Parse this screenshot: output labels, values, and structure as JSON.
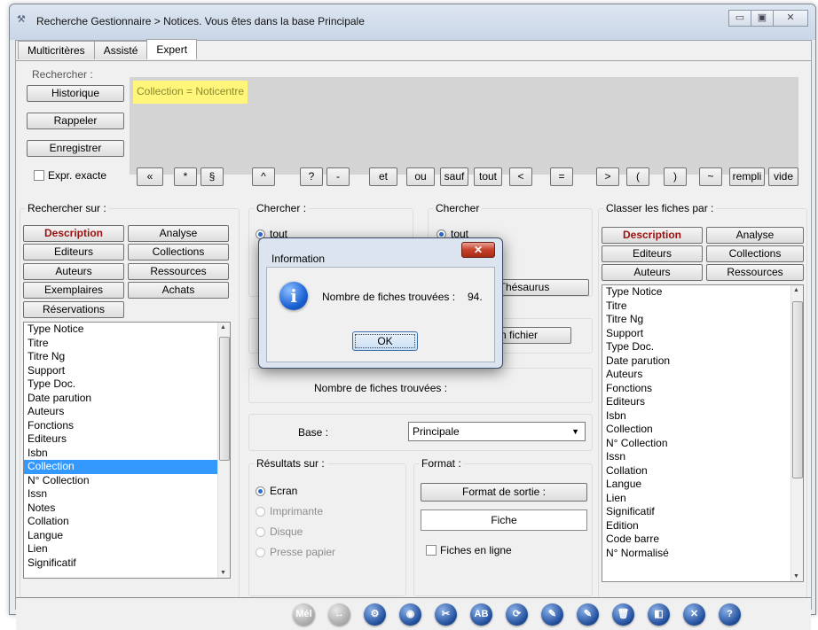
{
  "window": {
    "title": "Recherche Gestionnaire > Notices.  Vous êtes dans la base Principale",
    "controls": {
      "minimize": "▭",
      "maximize": "▣",
      "close": "✕"
    }
  },
  "tabs": [
    {
      "label": "Multicritères",
      "active": false
    },
    {
      "label": "Assisté",
      "active": false
    },
    {
      "label": "Expert",
      "active": true
    }
  ],
  "search": {
    "label": "Rechercher :",
    "query": "Collection = Noticentre",
    "buttons": {
      "historique": "Historique",
      "rappeler": "Rappeler",
      "enregistrer": "Enregistrer"
    },
    "exact_label": "Expr. exacte"
  },
  "operators": [
    "«",
    "*",
    "§",
    "^",
    "?",
    "-",
    "et",
    "ou",
    "sauf",
    "tout",
    "<",
    "=",
    ">",
    "(",
    ")",
    "~",
    "rempli",
    "vide"
  ],
  "rechercher_sur": {
    "label": "Rechercher sur :",
    "buttons": [
      "Description",
      "Analyse",
      "Editeurs",
      "Collections",
      "Auteurs",
      "Ressources",
      "Exemplaires",
      "Achats",
      "Réservations"
    ],
    "fields": [
      "Type Notice",
      "Titre",
      "Titre Ng",
      "Support",
      "Type Doc.",
      "Date parution",
      "Auteurs",
      "Fonctions",
      "Editeurs",
      "Isbn",
      "Collection",
      "N° Collection",
      "Issn",
      "Notes",
      "Collation",
      "Langue",
      "Lien",
      "Significatif"
    ],
    "selected": "Collection"
  },
  "chercher": {
    "label": "Chercher :",
    "option_tout": "tout"
  },
  "chercher2": {
    "label": "Chercher",
    "option_tout": "tout",
    "thesaurus_btn": "Thésaurus",
    "fichier_btn": "En fichier"
  },
  "resultat": {
    "count_label": "Nombre de fiches trouvées :"
  },
  "base": {
    "label": "Base :",
    "value": "Principale"
  },
  "resultats_sur": {
    "label": "Résultats sur :",
    "options": [
      {
        "label": "Ecran",
        "checked": true,
        "disabled": false
      },
      {
        "label": "Imprimante",
        "checked": false,
        "disabled": true
      },
      {
        "label": "Disque",
        "checked": false,
        "disabled": true
      },
      {
        "label": "Presse papier",
        "checked": false,
        "disabled": true
      }
    ]
  },
  "format": {
    "label": "Format :",
    "button": "Format de sortie :",
    "value": "Fiche",
    "en_ligne": "Fiches en ligne"
  },
  "classer": {
    "label": "Classer les fiches par :",
    "buttons": [
      "Description",
      "Analyse",
      "Editeurs",
      "Collections",
      "Auteurs",
      "Ressources"
    ],
    "fields": [
      "Type Notice",
      "Titre",
      "Titre Ng",
      "Support",
      "Type Doc.",
      "Date parution",
      "Auteurs",
      "Fonctions",
      "Editeurs",
      "Isbn",
      "Collection",
      "N° Collection",
      "Issn",
      "Collation",
      "Langue",
      "Lien",
      "Significatif",
      "Edition",
      "Code barre",
      "N° Normalisé"
    ]
  },
  "toolbar": [
    "Mél",
    "↔",
    "⚙",
    "◉",
    "✂",
    "AB",
    "⟳",
    "✎",
    "✎",
    "🗑",
    "◧",
    "✕",
    "?"
  ],
  "dialog": {
    "title": "Information",
    "close": "✕",
    "message": "Nombre de fiches trouvées :",
    "count": "94.",
    "ok": "OK"
  }
}
